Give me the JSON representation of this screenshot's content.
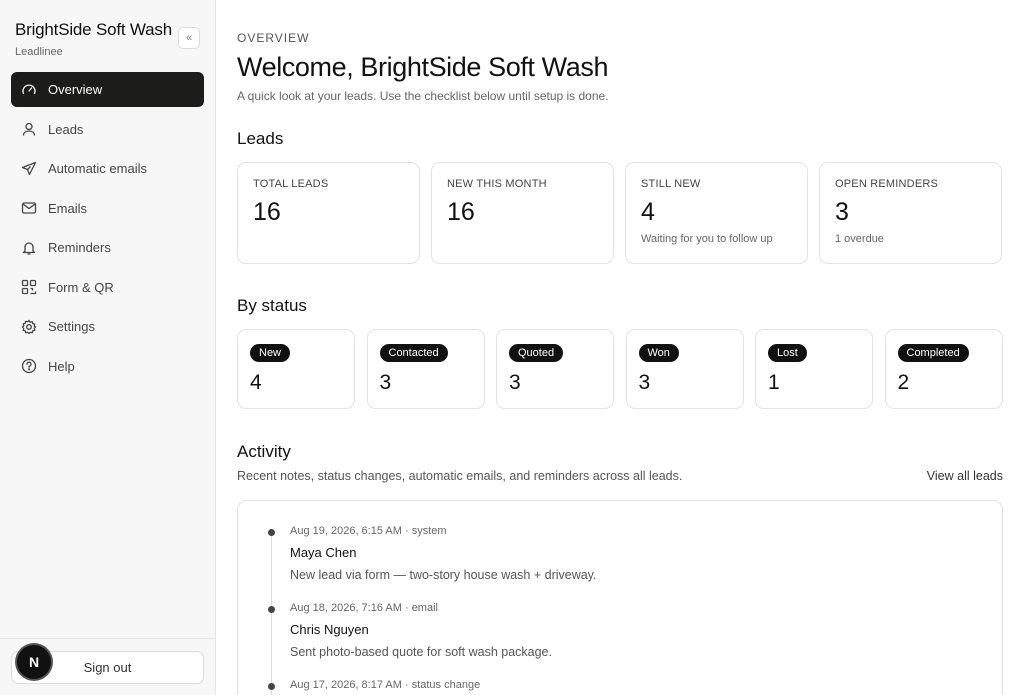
{
  "sidebar": {
    "brand_name": "BrightSide Soft Wash",
    "brand_sub": "Leadlinee",
    "collapse_icon": "«",
    "items": [
      {
        "label": "Overview",
        "icon": "gauge-icon",
        "active": true
      },
      {
        "label": "Leads",
        "icon": "user-icon"
      },
      {
        "label": "Automatic emails",
        "icon": "send-icon"
      },
      {
        "label": "Emails",
        "icon": "mail-icon"
      },
      {
        "label": "Reminders",
        "icon": "bell-icon"
      },
      {
        "label": "Form & QR",
        "icon": "qr-code-icon"
      },
      {
        "label": "Settings",
        "icon": "gear-icon"
      },
      {
        "label": "Help",
        "icon": "help-circle-icon"
      }
    ],
    "avatar_initial": "N",
    "signout_label": "Sign out"
  },
  "header": {
    "eyebrow": "OVERVIEW",
    "title": "Welcome, BrightSide Soft Wash",
    "subtitle": "A quick look at your leads. Use the checklist below until setup is done."
  },
  "leads": {
    "heading": "Leads",
    "cards": [
      {
        "label": "TOTAL LEADS",
        "value": "16",
        "note": ""
      },
      {
        "label": "NEW THIS MONTH",
        "value": "16",
        "note": ""
      },
      {
        "label": "STILL NEW",
        "value": "4",
        "note": "Waiting for you to follow up"
      },
      {
        "label": "OPEN REMINDERS",
        "value": "3",
        "note": "1 overdue"
      }
    ]
  },
  "status": {
    "heading": "By status",
    "cards": [
      {
        "label": "New",
        "value": "4"
      },
      {
        "label": "Contacted",
        "value": "3"
      },
      {
        "label": "Quoted",
        "value": "3"
      },
      {
        "label": "Won",
        "value": "3"
      },
      {
        "label": "Lost",
        "value": "1"
      },
      {
        "label": "Completed",
        "value": "2"
      }
    ]
  },
  "activity": {
    "heading": "Activity",
    "subtitle": "Recent notes, status changes, automatic emails, and reminders across all leads.",
    "view_all": "View all leads",
    "items": [
      {
        "meta": "Aug 19, 2026, 6:15 AM · system",
        "name": "Maya Chen",
        "text": "New lead via form — two-story house wash + driveway."
      },
      {
        "meta": "Aug 18, 2026, 7:16 AM · email",
        "name": "Chris Nguyen",
        "text": "Sent photo-based quote for soft wash package."
      },
      {
        "meta": "Aug 17, 2026, 8:17 AM · status change",
        "name": "",
        "text": ""
      }
    ]
  }
}
